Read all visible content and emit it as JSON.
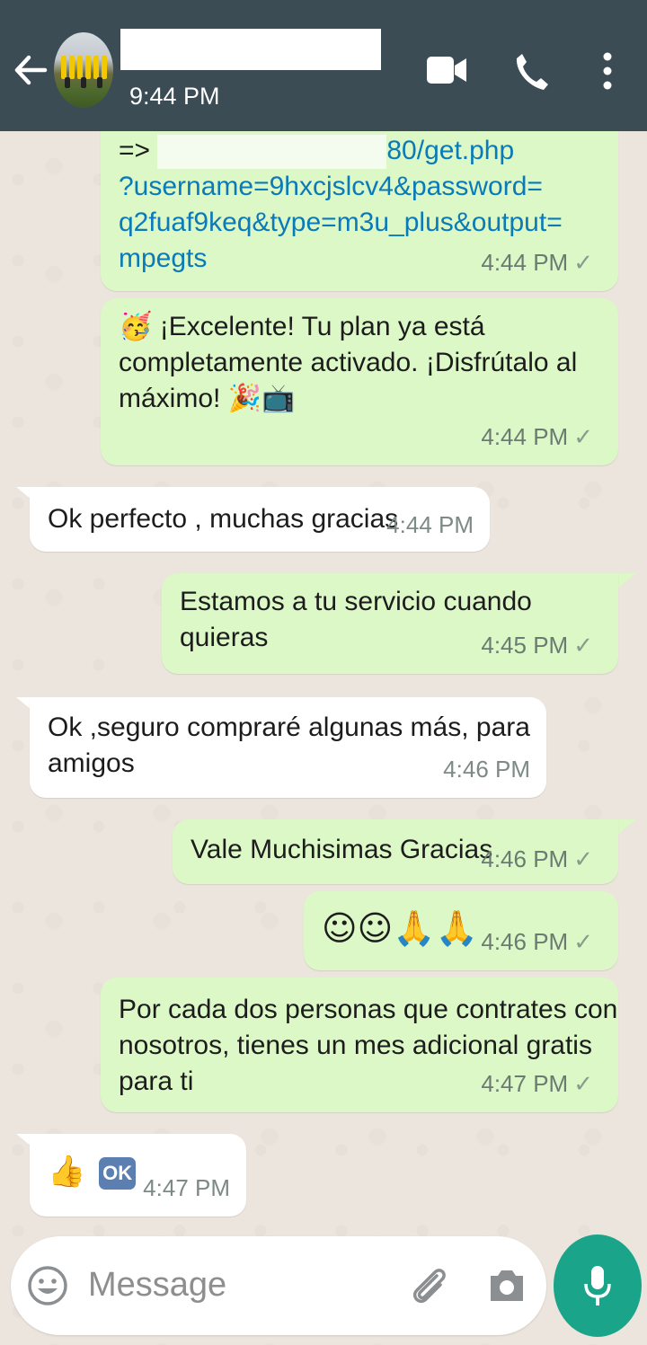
{
  "header": {
    "last_seen": "9:44 PM",
    "icons": [
      "back-arrow-icon",
      "video-call-icon",
      "phone-icon",
      "more-vert-icon"
    ]
  },
  "messages": [
    {
      "dir": "out",
      "lines": [
        "=> ",
        "80/get.php",
        "?username=9hxcjslcv4&password=",
        "q2fuaf9keq&type=m3u_plus&output=",
        "mpegts"
      ],
      "time": "4:44 PM"
    },
    {
      "dir": "out",
      "text_line1": "¡Excelente! Tu plan ya está",
      "text_line2": "completamente activado. ¡Disfrútalo al",
      "text_line3": "máximo! ",
      "emoji_start": "🥳",
      "emoji_end": "🎉📺",
      "time": "4:44 PM"
    },
    {
      "dir": "in",
      "text": "Ok perfecto , muchas gracias",
      "time": "4:44 PM"
    },
    {
      "dir": "out",
      "text": "Estamos a tu servicio cuando quieras",
      "time": "4:45 PM"
    },
    {
      "dir": "in",
      "text_line1": "Ok ,seguro compraré algunas más, para",
      "text_line2": "amigos",
      "time": "4:46 PM"
    },
    {
      "dir": "out",
      "text": "Vale Muchisimas Gracias",
      "time": "4:46 PM"
    },
    {
      "dir": "out",
      "text": "☺☺🙏🙏",
      "time": "4:46 PM"
    },
    {
      "dir": "out",
      "text_line1": "Por cada dos personas que contrates con",
      "text_line2": "nosotros, tienes un mes adicional gratis",
      "text_line3": "para ti",
      "time": "4:47 PM"
    },
    {
      "dir": "in",
      "text": "👍",
      "badge": "OK",
      "time": "4:47 PM"
    }
  ],
  "tick": "✓",
  "input": {
    "placeholder": "Message",
    "icons": [
      "emoji-icon",
      "attach-icon",
      "camera-icon",
      "mic-icon"
    ]
  },
  "colors": {
    "header": "#3b4c55",
    "outgoing": "#dcf8c6",
    "incoming": "#ffffff",
    "accent": "#1aa58a",
    "link": "#0b7ab8"
  }
}
